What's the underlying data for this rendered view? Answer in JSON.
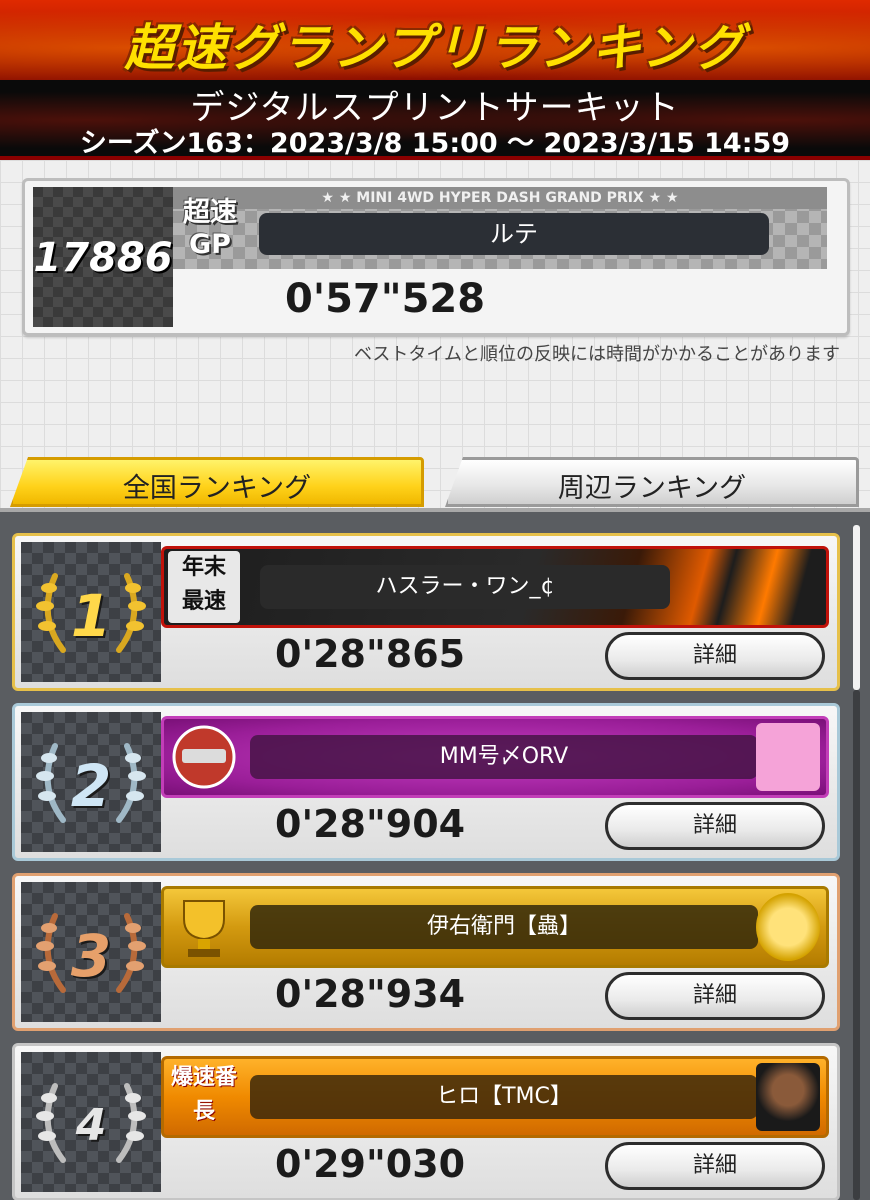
{
  "header": {
    "title": "超速グランプリランキング",
    "subtitle": "デジタルスプリントサーキット",
    "season": "シーズン163：2023/3/8  15:00 ～ 2023/3/15  14:59"
  },
  "my_record": {
    "rank": "17886",
    "plate_caption": "★ ★ MINI 4WD HYPER DASH GRAND PRIX ★ ★",
    "logo_text": "超速 GP",
    "name": "ルテ",
    "time": "0'57\"528"
  },
  "note": "ベストタイムと順位の反映には時間がかかることがあります",
  "tabs": {
    "national": "全国ランキング",
    "nearby": "周辺ランキング"
  },
  "rows": [
    {
      "rank": "1",
      "badge": "年末 最速",
      "name": "ハスラー・ワン_¢",
      "time": "0'28\"865",
      "detail": "詳細"
    },
    {
      "rank": "2",
      "badge": "",
      "name": "MM号〆ORV",
      "time": "0'28\"904",
      "detail": "詳細"
    },
    {
      "rank": "3",
      "badge": "",
      "name": "伊右衛門【蟲】",
      "time": "0'28\"934",
      "detail": "詳細"
    },
    {
      "rank": "4",
      "badge": "爆速番長",
      "name": "ヒロ【TMC】",
      "time": "0'29\"030",
      "detail": "詳細"
    }
  ],
  "colors": {
    "title_yellow": "#ffe000",
    "header_red": "#c41000",
    "tab_active": "#ffd21a",
    "gold": "#ffd84a",
    "silver": "#cfe6f5",
    "bronze": "#e7a06a"
  }
}
